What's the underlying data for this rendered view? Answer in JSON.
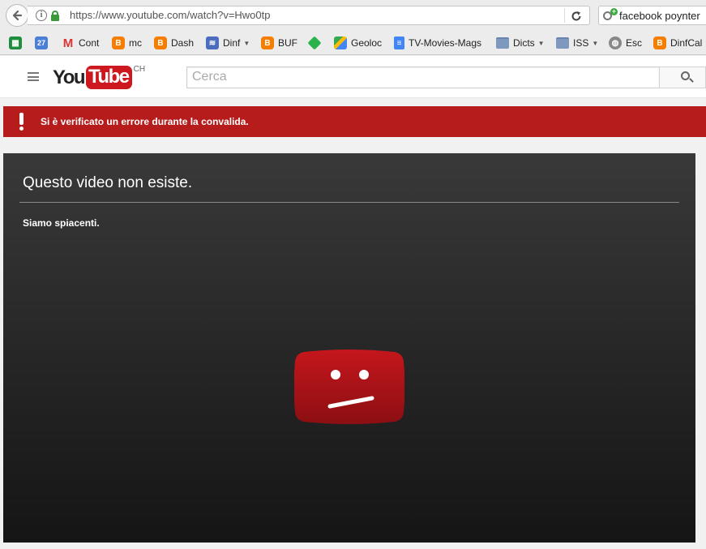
{
  "browser": {
    "url": "https://www.youtube.com/watch?v=Hwo0tp",
    "search_query": "facebook poynter",
    "bookmarks": [
      {
        "label": "",
        "icon": "spreadsheet-icon"
      },
      {
        "label": "",
        "icon": "calendar-icon",
        "badge": "27"
      },
      {
        "label": "Cont",
        "icon": "gmail-icon"
      },
      {
        "label": "mc",
        "icon": "blogger-icon"
      },
      {
        "label": "Dash",
        "icon": "blogger-icon"
      },
      {
        "label": "Dinf",
        "icon": "rss-icon"
      },
      {
        "label": "BUF",
        "icon": "blogger-icon"
      },
      {
        "label": "",
        "icon": "feedly-icon"
      },
      {
        "label": "Geoloc",
        "icon": "maps-icon"
      },
      {
        "label": "TV-Movies-Mags",
        "icon": "docs-icon"
      },
      {
        "label": "Dicts",
        "icon": "folder-icon"
      },
      {
        "label": "ISS",
        "icon": "folder-icon"
      },
      {
        "label": "Esc",
        "icon": "globe-icon"
      },
      {
        "label": "DinfCal",
        "icon": "blogger-icon"
      }
    ]
  },
  "youtube": {
    "logo_you": "You",
    "logo_tube": "Tube",
    "region": "CH",
    "search_placeholder": "Cerca",
    "alert_message": "Si è verificato un errore durante la convalida.",
    "error_title": "Questo video non esiste.",
    "error_subtitle": "Siamo spiacenti.",
    "brand_red": "#cc181e",
    "alert_red": "#b71c1c"
  }
}
